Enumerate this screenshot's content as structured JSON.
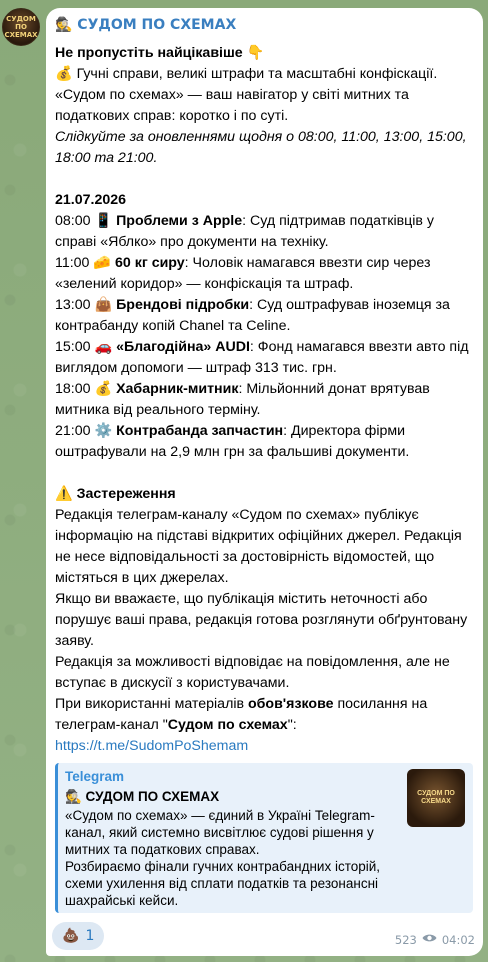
{
  "channel": {
    "avatar_text": "СУДОМ ПО СХЕМАХ",
    "sender_name": "🕵️ СУДОМ ПО СХЕМАХ"
  },
  "message": {
    "lines": [
      "Не пропустіть найцікавіше 👇",
      "💰 Гучні справи, великі штрафи та масштабні конфіскації.",
      "«Судом по схемах» — ваш навігатор у світі митних та податкових справ: коротко і по суті.",
      "Слідкуйте за оновленнями щодня о 08:00, 11:00, 13:00, 15:00, 18:00 та 21:00."
    ],
    "date": "21.07.2026",
    "schedule": [
      {
        "time": "08:00 📱",
        "title": "Проблеми з Apple",
        "text": ": Суд підтримав податківців у справі «Яблко» про документи на техніку."
      },
      {
        "time": "11:00 🧀",
        "title": "60 кг сиру",
        "text": ": Чоловік намагався ввезти сир через «зелений коридор» — конфіскація та штраф."
      },
      {
        "time": "13:00 👜",
        "title": "Брендові підробки",
        "text": ": Суд оштрафував іноземця за контрабанду копій Chanel та Celine."
      },
      {
        "time": "15:00 🚗",
        "title": "«Благодійна» AUDI",
        "text": ": Фонд намагався ввезти авто під виглядом допомоги — штраф 313 тис. грн."
      },
      {
        "time": "18:00 💰",
        "title": "Хабарник-митник",
        "text": ": Мільйонний донат врятував митника від реального терміну."
      },
      {
        "time": "21:00 ⚙️",
        "title": "Контрабанда запчастин",
        "text": ": Директора фірми оштрафували на 2,9 млн грн за фальшиві документи."
      }
    ],
    "disclaimer_title": "⚠️ Застереження",
    "disclaimer": [
      "Редакція телеграм-каналу «Судом по схемах» публікує інформацію на підставі відкритих офіційних джерел. Редакція не несе відповідальності за достовірність відомостей, що містяться в цих джерелах.",
      "Якщо ви вважаєте, що публікація містить неточності або порушує ваші права, редакція готова розглянути обґрунтовану заяву.",
      "Редакція за можливості відповідає на повідомлення, але не вступає в дискусії з користувачами."
    ],
    "usage_prefix": "При використанні матеріалів ",
    "usage_bold": "обов'язкове",
    "usage_mid": " посилання на телеграм-канал \"",
    "usage_channel": "Судом по схемах",
    "usage_suffix": "\":",
    "link": "https://t.me/SudomPoShemam"
  },
  "preview": {
    "site": "Telegram",
    "title": "🕵️ СУДОМ ПО СХЕМАХ",
    "description_1": "«Судом по схемах» — єдиний в Україні Telegram-канал, який системно висвітлює судові рішення у митних та податкових справах.",
    "description_2": "Розбираємо фінали гучних контрабандних історій, схеми ухилення від сплати податків та резонансні шахрайські кейси.",
    "thumb_text": "СУДОМ ПО СХЕМАХ"
  },
  "footer": {
    "reaction_emoji": "💩",
    "reaction_count": "1",
    "views": "523",
    "time": "04:02"
  },
  "icons": {
    "views": "eye-icon"
  },
  "colors": {
    "accent": "#3a7fc0",
    "link": "#2a7ac0",
    "preview_bar": "#3a8fd8"
  }
}
